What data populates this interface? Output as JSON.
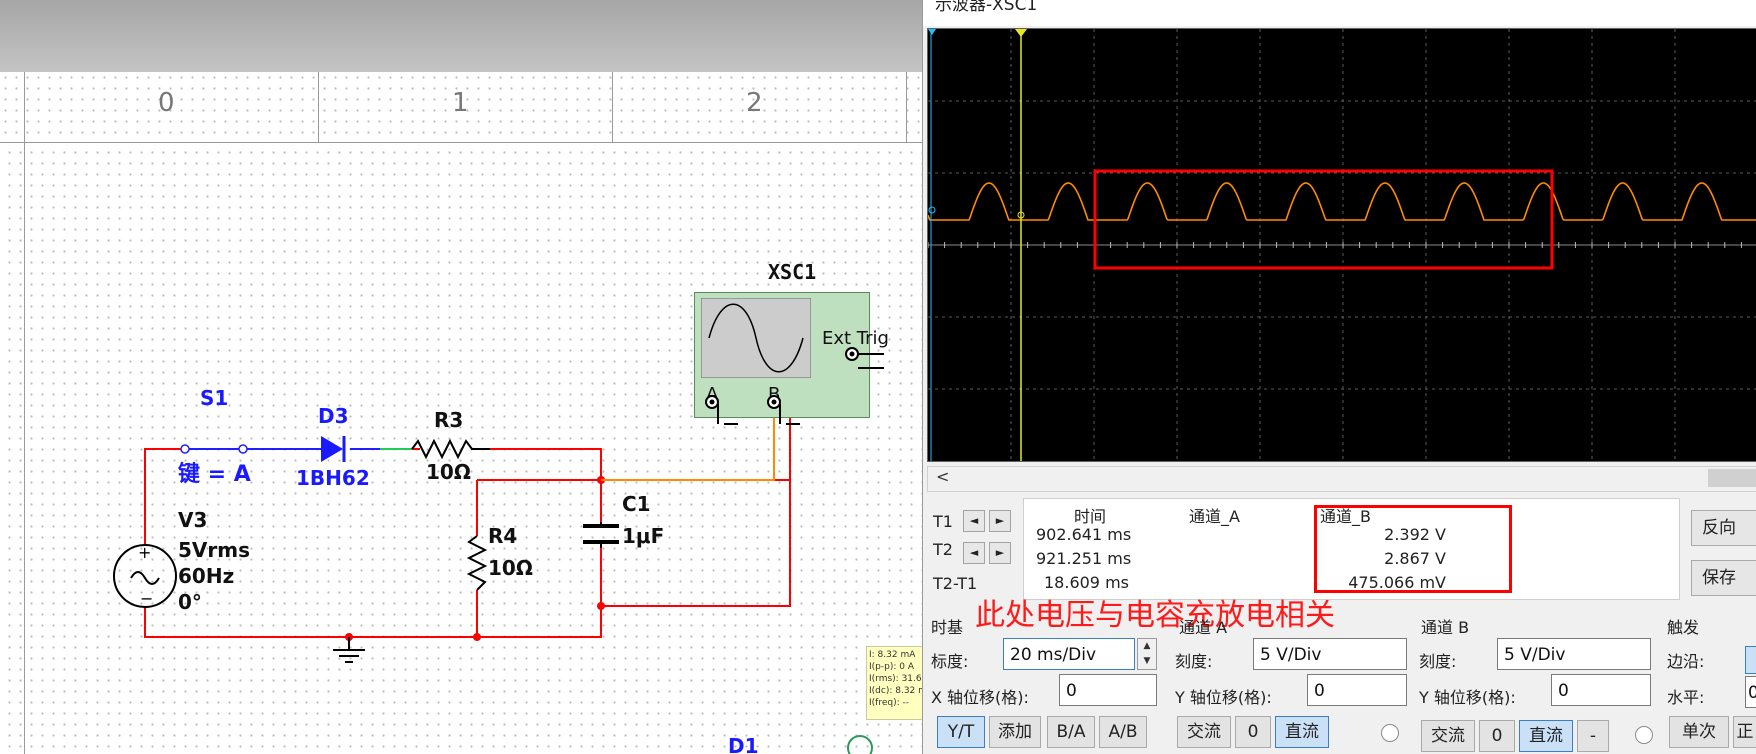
{
  "scope_window": {
    "title": "示波器-XSC1"
  },
  "ruler": {
    "labels": [
      "0",
      "1",
      "2"
    ]
  },
  "components": {
    "switch": {
      "name": "S1",
      "key": "键 = A"
    },
    "diode": {
      "name": "D3",
      "model": "1BH62"
    },
    "r3": {
      "name": "R3",
      "value": "10Ω"
    },
    "r4": {
      "name": "R4",
      "value": "10Ω"
    },
    "c1": {
      "name": "C1",
      "value": "1μF"
    },
    "source": {
      "name": "V3",
      "amplitude": "5Vrms",
      "frequency": "60Hz",
      "phase": "0°"
    },
    "scope": {
      "name": "XSC1",
      "ext_trig": "Ext Trig",
      "pin_a": "A",
      "pin_b": "B"
    },
    "d1": {
      "name": "D1"
    }
  },
  "probe_tooltip": {
    "lines": [
      "I: 8.32 mA",
      "I(p-p): 0 A",
      "I(rms): 31.6",
      "I(dc): 8.32 m",
      "I(freq): --"
    ]
  },
  "readout": {
    "headers": {
      "time": "时间",
      "channel_a": "通道_A",
      "channel_b": "通道_B"
    },
    "rows": [
      {
        "label": "T1",
        "time": "902.641 ms",
        "channel_b": "2.392 V"
      },
      {
        "label": "T2",
        "time": "921.251 ms",
        "channel_b": "2.867 V"
      },
      {
        "label": "T2-T1",
        "time": "18.609 ms",
        "channel_b": "475.066 mV"
      }
    ],
    "left_arrow": "◄",
    "right_arrow": "►"
  },
  "buttons_right": {
    "reverse": "反向",
    "save": "保存"
  },
  "annotation": {
    "text": "此处电压与电容充放电相关",
    "color": "#ff1a1a"
  },
  "timebase": {
    "title": "时基",
    "scale_label": "标度:",
    "scale_value": "20 ms/Div",
    "xpos_label": "X 轴位移(格):",
    "xpos_value": "0",
    "modes": [
      "Y/T",
      "添加",
      "B/A",
      "A/B"
    ],
    "active_mode": "Y/T"
  },
  "channel_a": {
    "title": "通道 A",
    "scale_label": "刻度:",
    "scale_value": "5  V/Div",
    "ypos_label": "Y 轴位移(格):",
    "ypos_value": "0",
    "coupling": [
      "交流",
      "0",
      "直流"
    ],
    "active_coupling": "直流"
  },
  "channel_b": {
    "title": "通道 B",
    "scale_label": "刻度:",
    "scale_value": "5  V/Div",
    "ypos_label": "Y 轴位移(格):",
    "ypos_value": "0",
    "coupling": [
      "交流",
      "0",
      "直流",
      "-"
    ],
    "active_coupling": "直流"
  },
  "trigger": {
    "title": "触发",
    "edge_label": "边沿:",
    "level_label": "水平:",
    "level_value": "0",
    "single": "单次",
    "normal": "正"
  },
  "colors": {
    "wire": "#ff0000",
    "wire_scope": "#ff8c00",
    "trace": "#ff8c00",
    "cursor": "#ffff00",
    "scope_body": "#bfe0bf",
    "highlight": "#ff0000"
  }
}
